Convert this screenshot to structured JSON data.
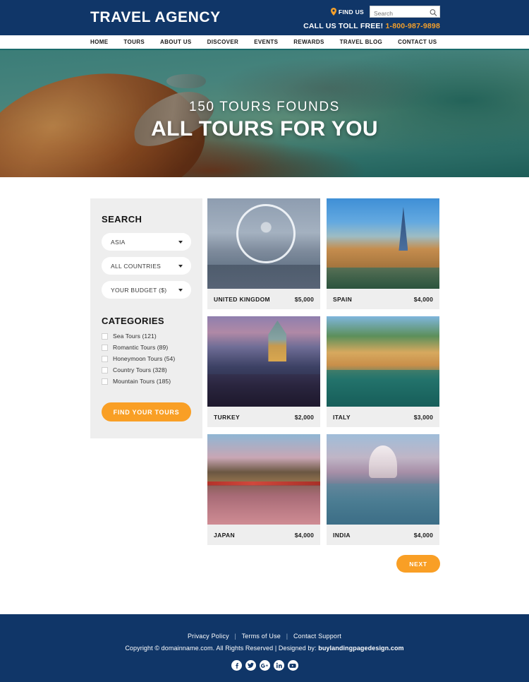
{
  "header": {
    "logo": "TRAVEL AGENCY",
    "find_us_label": "FIND US",
    "find_us_icon": "location-pin-icon",
    "search_placeholder": "Search",
    "search_value": "",
    "search_icon": "search-icon",
    "call_label": "CALL US TOLL FREE!",
    "phone": "1-800-987-9898"
  },
  "nav": {
    "items": [
      {
        "label": "HOME"
      },
      {
        "label": "TOURS"
      },
      {
        "label": "ABOUT US"
      },
      {
        "label": "DISCOVER"
      },
      {
        "label": "EVENTS"
      },
      {
        "label": "REWARDS"
      },
      {
        "label": "TRAVEL BLOG"
      },
      {
        "label": "CONTACT US"
      }
    ]
  },
  "hero": {
    "subtitle": "150 TOURS FOUNDS",
    "title": "ALL TOURS FOR YOU",
    "scene": "underwater-sea-turtle"
  },
  "sidebar": {
    "search_title": "SEARCH",
    "selects": [
      {
        "value": "ASIA",
        "name": "region-select"
      },
      {
        "value": "ALL COUNTRIES",
        "name": "country-select"
      },
      {
        "value": "YOUR BUDGET ($)",
        "name": "budget-select"
      }
    ],
    "categories_title": "CATEGORIES",
    "categories": [
      {
        "label": "Sea Tours (121)",
        "checked": false
      },
      {
        "label": "Romantic Tours (89)",
        "checked": false
      },
      {
        "label": "Honeymoon Tours (54)",
        "checked": false
      },
      {
        "label": "Country Tours (328)",
        "checked": false
      },
      {
        "label": "Mountain Tours (185)",
        "checked": false
      }
    ],
    "find_button": "FIND YOUR TOURS"
  },
  "tours": [
    {
      "name": "UNITED KINGDOM",
      "price": "$5,000",
      "photo": "ph-uk",
      "alt": "london-eye"
    },
    {
      "name": "SPAIN",
      "price": "$4,000",
      "photo": "ph-es",
      "alt": "park-guell-barcelona"
    },
    {
      "name": "TURKEY",
      "price": "$2,000",
      "photo": "ph-tr",
      "alt": "galata-tower-istanbul"
    },
    {
      "name": "ITALY",
      "price": "$3,000",
      "photo": "ph-it",
      "alt": "italian-harbor-boats"
    },
    {
      "name": "JAPAN",
      "price": "$4,000",
      "photo": "ph-jp",
      "alt": "matsumoto-castle-red-bridge"
    },
    {
      "name": "INDIA",
      "price": "$4,000",
      "photo": "ph-in",
      "alt": "taj-mahal"
    }
  ],
  "pagination": {
    "next_label": "NEXT"
  },
  "footer": {
    "links": [
      "Privacy Policy",
      "Terms of Use",
      "Contact Support"
    ],
    "separator": "|",
    "copyright": "Copyright © domainname.com. All Rights Reserved  |  Designed by:",
    "brand": "buylandingpagedesign.com",
    "socials": [
      "facebook-icon",
      "twitter-icon",
      "google-plus-icon",
      "linkedin-icon",
      "youtube-icon"
    ]
  },
  "colors": {
    "navy": "#103668",
    "orange": "#f99f25",
    "teal_rule": "#1b6b6b",
    "panel_grey": "#eeeeee"
  }
}
